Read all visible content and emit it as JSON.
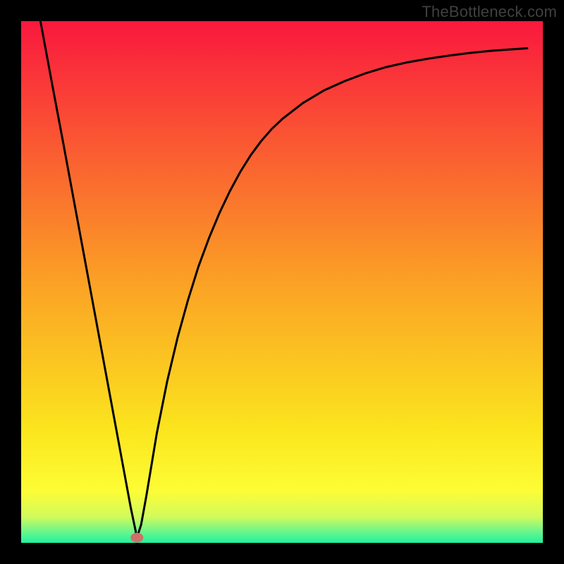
{
  "watermark": "TheBottleneck.com",
  "chart_data": {
    "type": "line",
    "title": "",
    "xlabel": "",
    "ylabel": "",
    "xlim": [
      0,
      1
    ],
    "ylim": [
      0,
      1
    ],
    "grid": false,
    "series": [
      {
        "name": "curve",
        "x": [
          0.037,
          0.06,
          0.08,
          0.1,
          0.12,
          0.14,
          0.16,
          0.18,
          0.2,
          0.21,
          0.22,
          0.222,
          0.23,
          0.24,
          0.26,
          0.28,
          0.3,
          0.32,
          0.34,
          0.36,
          0.38,
          0.4,
          0.42,
          0.44,
          0.46,
          0.48,
          0.5,
          0.54,
          0.58,
          0.62,
          0.66,
          0.7,
          0.74,
          0.78,
          0.82,
          0.86,
          0.9,
          0.94,
          0.97
        ],
        "y": [
          1.0,
          0.876,
          0.77,
          0.662,
          0.554,
          0.446,
          0.338,
          0.23,
          0.122,
          0.068,
          0.02,
          0.01,
          0.035,
          0.09,
          0.21,
          0.31,
          0.394,
          0.466,
          0.53,
          0.584,
          0.632,
          0.674,
          0.711,
          0.743,
          0.77,
          0.793,
          0.812,
          0.843,
          0.867,
          0.885,
          0.9,
          0.912,
          0.921,
          0.928,
          0.934,
          0.939,
          0.943,
          0.946,
          0.948
        ]
      }
    ],
    "marker": {
      "x": 0.222,
      "y": 0.01,
      "color": "#cd7168"
    },
    "background": {
      "type": "vertical-gradient",
      "stops": [
        {
          "offset": 0.0,
          "color": "#f9183e"
        },
        {
          "offset": 0.5,
          "color": "#fba125"
        },
        {
          "offset": 0.78,
          "color": "#fbe41e"
        },
        {
          "offset": 0.9,
          "color": "#fdfd35"
        },
        {
          "offset": 0.95,
          "color": "#d2fa5c"
        },
        {
          "offset": 0.975,
          "color": "#77f687"
        },
        {
          "offset": 1.0,
          "color": "#1ff29f"
        }
      ]
    },
    "frame": {
      "color": "#000000",
      "thickness_ratio": 0.037
    }
  }
}
